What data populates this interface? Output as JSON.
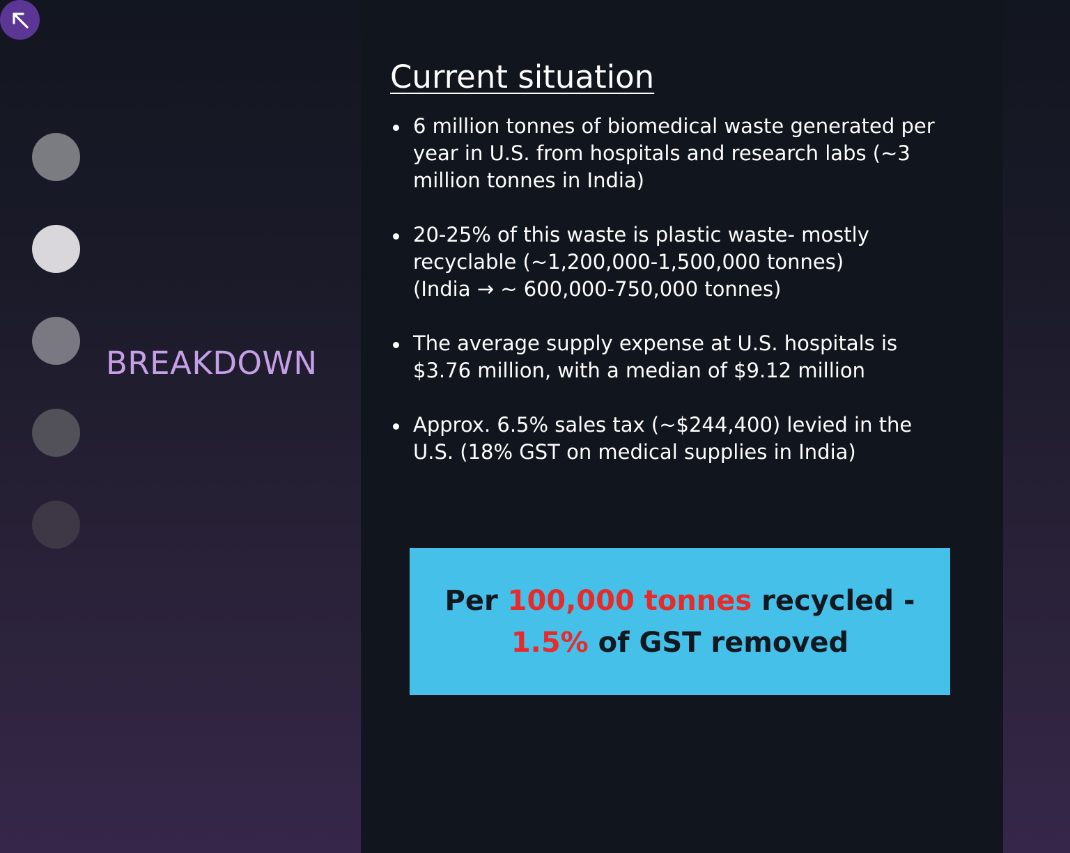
{
  "nav": {
    "back_icon": "arrow-up-left-icon",
    "dots": [
      {
        "color": "#7b7b82"
      },
      {
        "color": "#d9d7dc"
      },
      {
        "color": "#7a7880"
      },
      {
        "color": "#525058"
      },
      {
        "color": "#3e3846"
      }
    ],
    "active_index": 1
  },
  "section": {
    "label": "BREAKDOWN",
    "color": "#c5a0e6"
  },
  "slide": {
    "title": "Current situation",
    "bullets": [
      "6 million tonnes of biomedical waste generated per year in U.S. from hospitals and research labs (~3 million tonnes in India)",
      "20-25% of this waste is plastic waste- mostly recyclable (~1,200,000-1,500,000 tonnes)\n(India → ~ 600,000-750,000 tonnes)",
      "The  average supply expense at U.S. hospitals is $3.76 million, with a median of $9.12 million",
      "Approx. 6.5% sales tax (~$244,400) levied in the U.S. (18% GST on medical supplies in India)"
    ],
    "callout": {
      "prefix": "Per ",
      "highlight1": "100,000 tonnes",
      "middle": " recycled - ",
      "highlight2": "1.5%",
      "suffix": " of GST removed",
      "background": "#45c0e8",
      "highlight_color": "#e82a2a"
    }
  },
  "colors": {
    "panel": "#11151d",
    "accent": "#5b3694"
  }
}
